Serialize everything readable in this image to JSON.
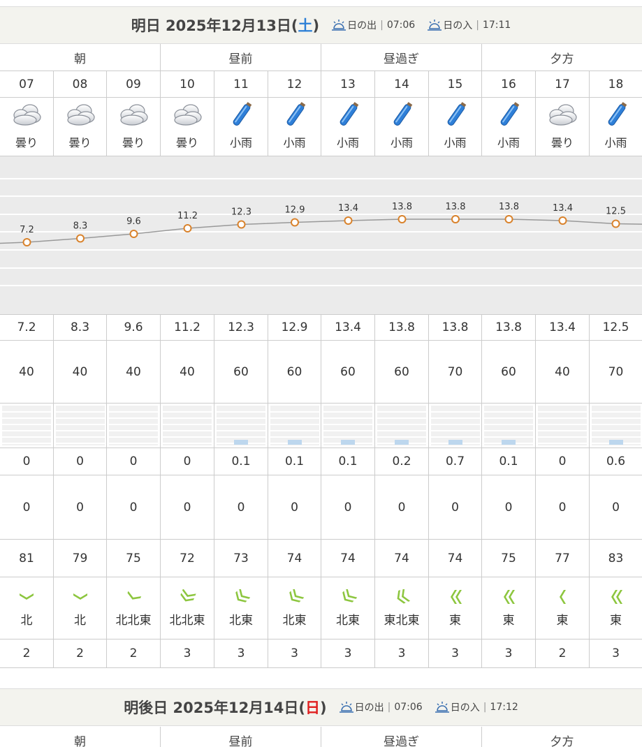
{
  "day1": {
    "title_prefix": "明日 2025年12月13日(",
    "dow": "土",
    "title_suffix": ")",
    "sunrise_label": "日の出",
    "sunrise_time": "07:06",
    "sunset_label": "日の入",
    "sunset_time": "17:11"
  },
  "day2": {
    "title_prefix": "明後日 2025年12月14日(",
    "dow": "日",
    "title_suffix": ")",
    "sunrise_label": "日の出",
    "sunrise_time": "07:06",
    "sunset_label": "日の入",
    "sunset_time": "17:12"
  },
  "periods": [
    "朝",
    "昼前",
    "昼過ぎ",
    "夕方"
  ],
  "hours": [
    "07",
    "08",
    "09",
    "10",
    "11",
    "12",
    "13",
    "14",
    "15",
    "16",
    "17",
    "18"
  ],
  "weather": [
    {
      "icon": "cloud-icon",
      "label": "曇り"
    },
    {
      "icon": "cloud-icon",
      "label": "曇り"
    },
    {
      "icon": "cloud-icon",
      "label": "曇り"
    },
    {
      "icon": "cloud-icon",
      "label": "曇り"
    },
    {
      "icon": "umbrella-icon",
      "label": "小雨"
    },
    {
      "icon": "umbrella-icon",
      "label": "小雨"
    },
    {
      "icon": "umbrella-icon",
      "label": "小雨"
    },
    {
      "icon": "umbrella-icon",
      "label": "小雨"
    },
    {
      "icon": "umbrella-icon",
      "label": "小雨"
    },
    {
      "icon": "umbrella-icon",
      "label": "小雨"
    },
    {
      "icon": "cloud-icon",
      "label": "曇り"
    },
    {
      "icon": "umbrella-icon",
      "label": "小雨"
    }
  ],
  "chart_data": {
    "type": "line",
    "categories": [
      "07",
      "08",
      "09",
      "10",
      "11",
      "12",
      "13",
      "14",
      "15",
      "16",
      "17",
      "18"
    ],
    "values": [
      7.2,
      8.3,
      9.6,
      11.2,
      12.3,
      12.9,
      13.4,
      13.8,
      13.8,
      13.8,
      13.4,
      12.5
    ],
    "data_labels": [
      "7.2",
      "8.3",
      "9.6",
      "11.2",
      "12.3",
      "12.9",
      "13.4",
      "13.8",
      "13.8",
      "13.8",
      "13.4",
      "12.5"
    ],
    "grid": true,
    "line_color": "#999999",
    "marker_color": "#d9822b"
  },
  "temperature": [
    "7.2",
    "8.3",
    "9.6",
    "11.2",
    "12.3",
    "12.9",
    "13.4",
    "13.8",
    "13.8",
    "13.8",
    "13.4",
    "12.5"
  ],
  "precip_prob": [
    "40",
    "40",
    "40",
    "40",
    "60",
    "60",
    "60",
    "60",
    "70",
    "60",
    "40",
    "70"
  ],
  "precip_bar": [
    0,
    0,
    0,
    0,
    0.1,
    0.1,
    0.1,
    0.2,
    0.7,
    0.1,
    0,
    0.6
  ],
  "precip": [
    "0",
    "0",
    "0",
    "0",
    "0.1",
    "0.1",
    "0.1",
    "0.2",
    "0.7",
    "0.1",
    "0",
    "0.6"
  ],
  "snow": [
    "0",
    "0",
    "0",
    "0",
    "0",
    "0",
    "0",
    "0",
    "0",
    "0",
    "0",
    "0"
  ],
  "humidity": [
    "81",
    "79",
    "75",
    "72",
    "73",
    "74",
    "74",
    "74",
    "74",
    "75",
    "77",
    "83"
  ],
  "wind_dir": [
    {
      "icon": "wind-north-icon",
      "label": "北",
      "strength": 1,
      "angle": 0
    },
    {
      "icon": "wind-north-icon",
      "label": "北",
      "strength": 1,
      "angle": 0
    },
    {
      "icon": "wind-north-northeast-icon",
      "label": "北北東",
      "strength": 1,
      "angle": 22
    },
    {
      "icon": "wind-north-northeast-icon",
      "label": "北北東",
      "strength": 2,
      "angle": 22
    },
    {
      "icon": "wind-northeast-icon",
      "label": "北東",
      "strength": 2,
      "angle": 45
    },
    {
      "icon": "wind-northeast-icon",
      "label": "北東",
      "strength": 2,
      "angle": 45
    },
    {
      "icon": "wind-northeast-icon",
      "label": "北東",
      "strength": 2,
      "angle": 45
    },
    {
      "icon": "wind-east-northeast-icon",
      "label": "東北東",
      "strength": 2,
      "angle": 67
    },
    {
      "icon": "wind-east-icon",
      "label": "東",
      "strength": 2,
      "angle": 90
    },
    {
      "icon": "wind-east-icon",
      "label": "東",
      "strength": 2,
      "angle": 90
    },
    {
      "icon": "wind-east-icon",
      "label": "東",
      "strength": 1,
      "angle": 90
    },
    {
      "icon": "wind-east-icon",
      "label": "東",
      "strength": 2,
      "angle": 90
    }
  ],
  "wind_speed": [
    "2",
    "2",
    "2",
    "3",
    "3",
    "3",
    "3",
    "3",
    "3",
    "3",
    "2",
    "3"
  ],
  "colors": {
    "header_bg": "#f3f3ee",
    "chart_bg": "#ebebeb",
    "wind_icon": "#8dc63f",
    "umbrella": "#2b7fd6",
    "saturday": "#2b7fd6",
    "sunday": "#e02020"
  }
}
